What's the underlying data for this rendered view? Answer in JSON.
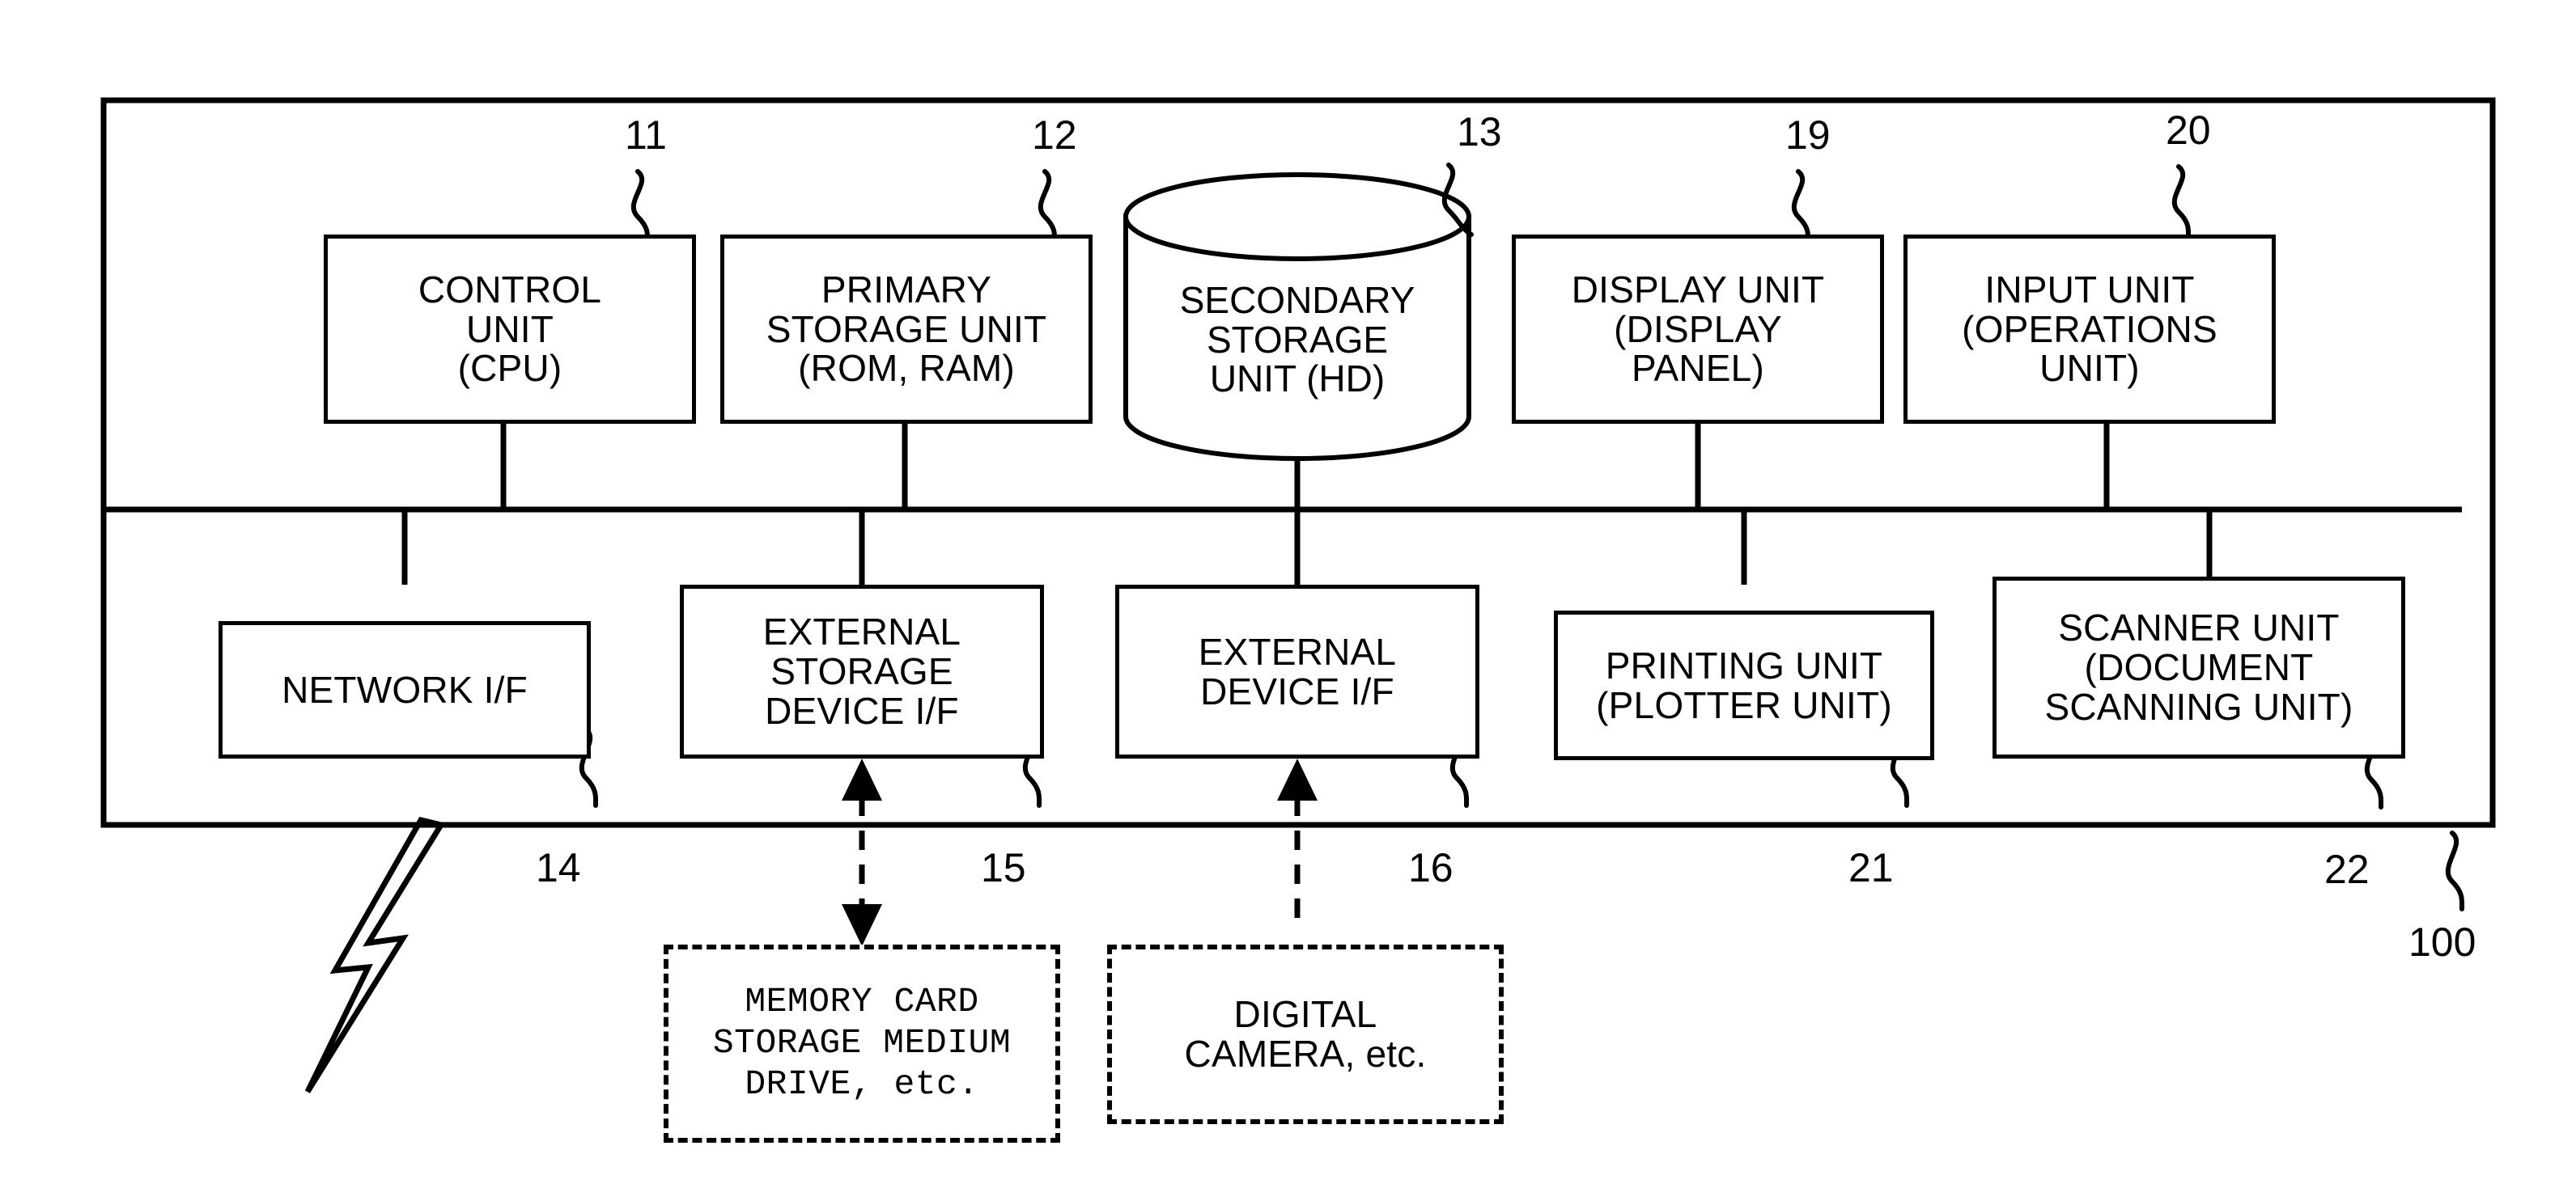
{
  "figure": {
    "type": "patent-block-diagram",
    "outer_frame_ref": "100",
    "bus_label": "",
    "top_row": [
      {
        "id": "control-unit",
        "text": "CONTROL\nUNIT\n(CPU)",
        "ref": "11",
        "shape": "rect"
      },
      {
        "id": "primary-storage-unit",
        "text": "PRIMARY\nSTORAGE UNIT\n(ROM, RAM)",
        "ref": "12",
        "shape": "rect"
      },
      {
        "id": "secondary-storage-unit",
        "text": "SECONDARY\nSTORAGE\nUNIT (HD)",
        "ref": "13",
        "shape": "cylinder"
      },
      {
        "id": "display-unit",
        "text": "DISPLAY UNIT\n(DISPLAY\nPANEL)",
        "ref": "19",
        "shape": "rect"
      },
      {
        "id": "input-unit",
        "text": "INPUT UNIT\n(OPERATIONS\nUNIT)",
        "ref": "20",
        "shape": "rect"
      }
    ],
    "bottom_row": [
      {
        "id": "network-if",
        "text": "NETWORK I/F",
        "ref": "14",
        "shape": "rect"
      },
      {
        "id": "external-storage-device-if",
        "text": "EXTERNAL\nSTORAGE\nDEVICE I/F",
        "ref": "15",
        "shape": "rect"
      },
      {
        "id": "external-device-if",
        "text": "EXTERNAL\nDEVICE I/F",
        "ref": "16",
        "shape": "rect"
      },
      {
        "id": "printing-unit",
        "text": "PRINTING UNIT\n(PLOTTER UNIT)",
        "ref": "21",
        "shape": "rect"
      },
      {
        "id": "scanner-unit",
        "text": "SCANNER UNIT\n(DOCUMENT\nSCANNING UNIT)",
        "ref": "22",
        "shape": "rect"
      }
    ],
    "external_devices": [
      {
        "id": "memory-card-drive",
        "text": "MEMORY CARD\nSTORAGE MEDIUM\nDRIVE, etc.",
        "style": "dashed",
        "font": "mono"
      },
      {
        "id": "digital-camera",
        "text": "DIGITAL\nCAMERA, etc.",
        "style": "dashed",
        "font": "sans"
      }
    ],
    "symbols": [
      {
        "id": "network-lightning-bolt",
        "name": "lightning-bolt-icon"
      }
    ],
    "colors": {
      "line": "#000000",
      "background": "#ffffff"
    }
  }
}
